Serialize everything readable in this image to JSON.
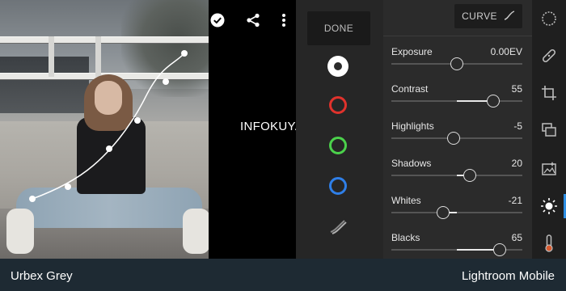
{
  "watermark": "INFOKUY.NET",
  "header": {
    "done_label": "DONE",
    "curve_label": "CURVE"
  },
  "icons": {
    "check": "check-icon",
    "share": "share-icon",
    "more": "more-vertical-icon",
    "curve": "curve-icon"
  },
  "channels": [
    {
      "name": "rgb",
      "color": "#ffffff",
      "selected": true
    },
    {
      "name": "red",
      "color": "#e0322c",
      "selected": false
    },
    {
      "name": "green",
      "color": "#4bd14b",
      "selected": false
    },
    {
      "name": "blue",
      "color": "#2f7fe8",
      "selected": false
    },
    {
      "name": "split-tone",
      "color": "#9a9a9a",
      "selected": false
    }
  ],
  "sliders": [
    {
      "label": "Exposure",
      "value": "0.00EV",
      "level": 0.5
    },
    {
      "label": "Contrast",
      "value": "55",
      "level": 0.775
    },
    {
      "label": "Highlights",
      "value": "-5",
      "level": 0.475
    },
    {
      "label": "Shadows",
      "value": "20",
      "level": 0.6
    },
    {
      "label": "Whites",
      "value": "-21",
      "level": 0.395
    },
    {
      "label": "Blacks",
      "value": "65",
      "level": 0.825
    }
  ],
  "tools": [
    {
      "name": "presets-icon",
      "active": false
    },
    {
      "name": "healing-icon",
      "active": false
    },
    {
      "name": "crop-icon",
      "active": false
    },
    {
      "name": "profiles-icon",
      "active": false
    },
    {
      "name": "auto-icon",
      "active": false
    },
    {
      "name": "light-icon",
      "active": true
    },
    {
      "name": "color-icon",
      "active": false
    }
  ],
  "banner": {
    "left": "Urbex Grey",
    "right": "Lightroom Mobile"
  }
}
